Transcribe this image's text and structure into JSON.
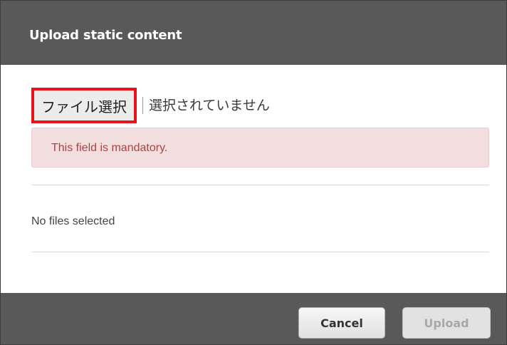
{
  "dialog": {
    "title": "Upload static content"
  },
  "file_input": {
    "button_label": "ファイル選択",
    "status_text": "選択されていません"
  },
  "validation": {
    "message": "This field is mandatory."
  },
  "files": {
    "label": "No files selected"
  },
  "footer": {
    "cancel_label": "Cancel",
    "upload_label": "Upload",
    "upload_disabled": true
  },
  "colors": {
    "header_bg": "#595959",
    "error_bg": "#f2dede",
    "error_text": "#a94442",
    "highlight_border": "#e8141c"
  }
}
